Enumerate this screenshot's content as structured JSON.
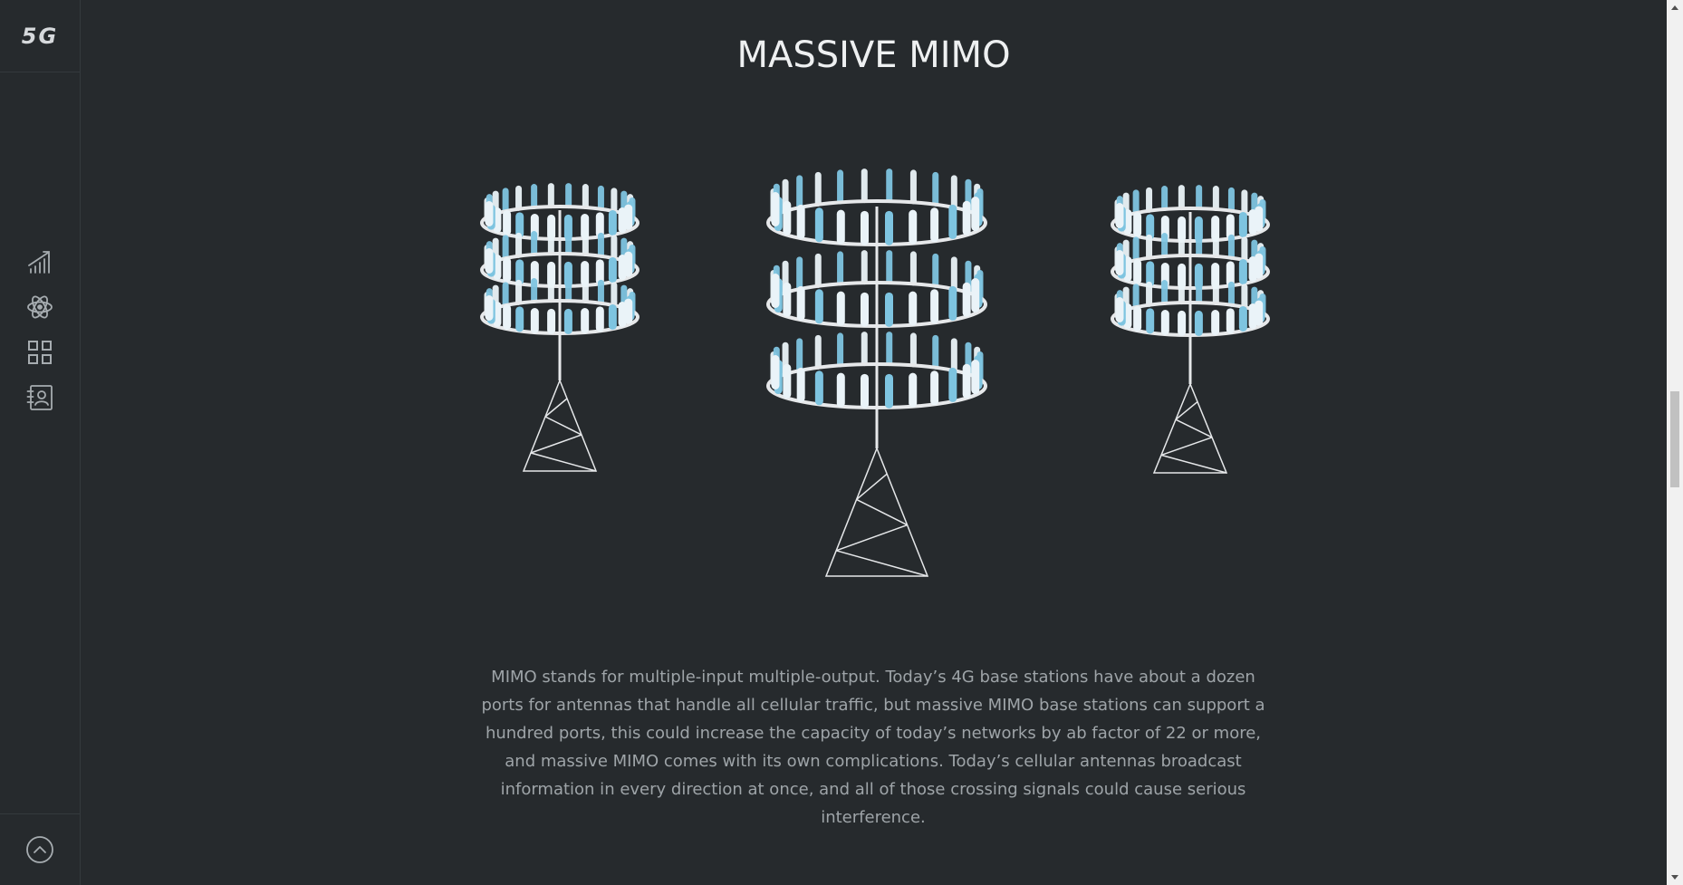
{
  "sidebar": {
    "logo_text": "5G",
    "nav": [
      {
        "icon": "chart-growth-icon"
      },
      {
        "icon": "atom-icon"
      },
      {
        "icon": "grid-icon"
      },
      {
        "icon": "contact-card-icon"
      }
    ],
    "bottom_icon": "chevron-up-circle-icon"
  },
  "main": {
    "title": "MASSIVE MIMO",
    "description": "MIMO stands for multiple-input multiple-output. Today’s 4G base stations have about a dozen ports for antennas that handle all cellular traffic, but massive MIMO base stations can support a hundred ports, this could increase the capacity of today’s networks by ab factor of 22 or more, and massive MIMO comes with its own complications. Today’s cellular antennas broadcast information in every direction at once, and all of those crossing signals could cause serious interference."
  },
  "colors": {
    "background": "#262a2d",
    "antenna_light": "#eaf3f8",
    "antenna_blue": "#7ec4e0",
    "ring": "#e6e8ea",
    "text": "#9ea4a8",
    "title": "#eef0f1"
  }
}
